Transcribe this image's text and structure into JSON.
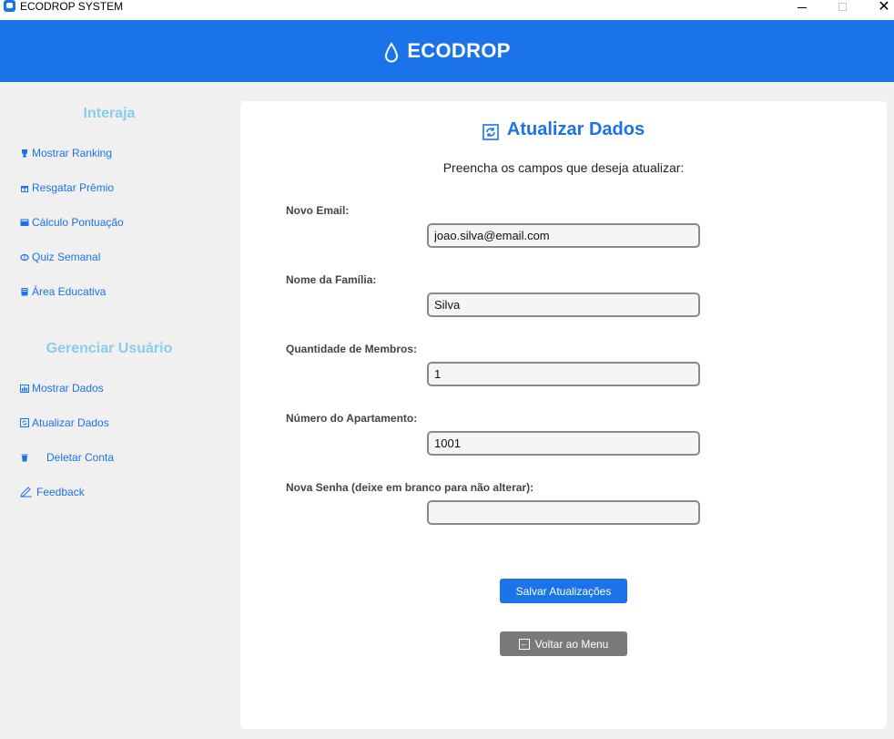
{
  "window": {
    "title": "ECODROP SYSTEM",
    "minimize_icon": "minimize-icon",
    "maximize_icon": "maximize-icon",
    "close_glyph": "✕"
  },
  "header": {
    "title": "ECODROP",
    "icon": "water-drop-icon",
    "background": "#1a73e8"
  },
  "sidebar": {
    "sections": [
      {
        "heading": "Interaja",
        "items": [
          {
            "label": "Mostrar Ranking",
            "icon": "trophy-icon"
          },
          {
            "label": "Resgatar Prêmio",
            "icon": "gift-icon"
          },
          {
            "label": "Cálculo Pontuação",
            "icon": "calculator-icon"
          },
          {
            "label": "Quiz Semanal",
            "icon": "brain-icon"
          },
          {
            "label": "Área Educativa",
            "icon": "book-icon"
          }
        ]
      },
      {
        "heading": "Gerenciar Usuário",
        "items": [
          {
            "label": "Mostrar Dados",
            "icon": "chart-icon"
          },
          {
            "label": "Atualizar Dados",
            "icon": "refresh-icon"
          },
          {
            "label": "Deletar Conta",
            "icon": "trash-icon"
          },
          {
            "label": "Feedback",
            "icon": "pencil-icon"
          }
        ]
      }
    ],
    "heading_color": "#87ceeb",
    "link_color": "#1a73e8"
  },
  "main": {
    "title": "Atualizar Dados",
    "title_icon": "refresh-icon",
    "subtitle": "Preencha os campos que deseja atualizar:",
    "fields": [
      {
        "label": "Novo Email:",
        "value": "joao.silva@email.com"
      },
      {
        "label": "Nome da Família:",
        "value": "Silva"
      },
      {
        "label": "Quantidade de Membros:",
        "value": "1"
      },
      {
        "label": "Número do Apartamento:",
        "value": "1001"
      },
      {
        "label": "Nova Senha (deixe em branco para não alterar):",
        "value": ""
      }
    ],
    "save_label": "Salvar Atualizações",
    "back_label": "Voltar ao Menu",
    "back_icon": "back-arrow-icon"
  }
}
